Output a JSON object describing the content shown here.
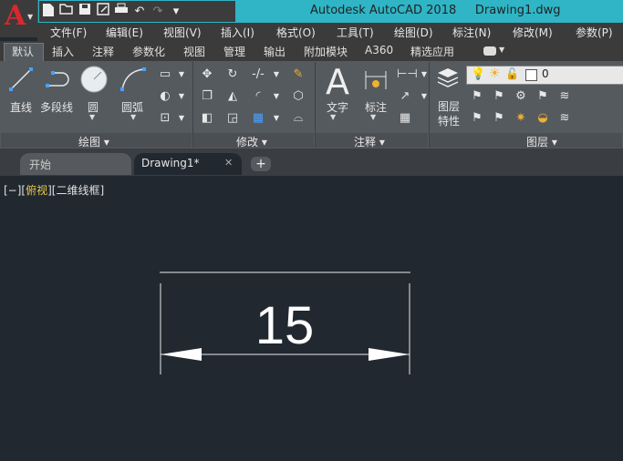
{
  "app": {
    "title": "Autodesk AutoCAD 2018     Drawing1.dwg",
    "logo_letter": "A"
  },
  "quick_access": [
    "new-icon",
    "open-icon",
    "save-icon",
    "save-as-icon",
    "print-icon",
    "undo-icon",
    "redo-icon",
    "customize-icon"
  ],
  "menubar": {
    "items": [
      "文件(F)",
      "编辑(E)",
      "视图(V)",
      "插入(I)",
      "格式(O)",
      "工具(T)",
      "绘图(D)",
      "标注(N)",
      "修改(M)",
      "参数(P)"
    ]
  },
  "ribbon_tabs": {
    "items": [
      "默认",
      "插入",
      "注释",
      "参数化",
      "视图",
      "管理",
      "输出",
      "附加模块",
      "A360",
      "精选应用"
    ],
    "active": "默认"
  },
  "ribbon": {
    "draw": {
      "line": "直线",
      "polyline": "多段线",
      "circle": "圆",
      "arc": "圆弧",
      "panel_title": "绘图 ▾"
    },
    "modify": {
      "panel_title": "修改 ▾"
    },
    "annotation": {
      "text": "文字",
      "dimension": "标注",
      "panel_title": "注释 ▾"
    },
    "layers": {
      "layer_props_1": "图层",
      "layer_props_2": "特性",
      "current_layer": "0",
      "panel_title": "图层 ▾"
    }
  },
  "doc_tabs": {
    "start": "开始",
    "drawing": "Drawing1*",
    "close": "✕",
    "new": "+"
  },
  "viewport": {
    "prefix": "[−][",
    "view": "俯视",
    "suffix": "][二维线框]"
  },
  "drawing": {
    "dimension_value": "15"
  },
  "colors": {
    "title_bar": "#2fb5c6",
    "canvas": "#212830",
    "logo": "#d8282e",
    "view_label": "#e8c84a"
  }
}
